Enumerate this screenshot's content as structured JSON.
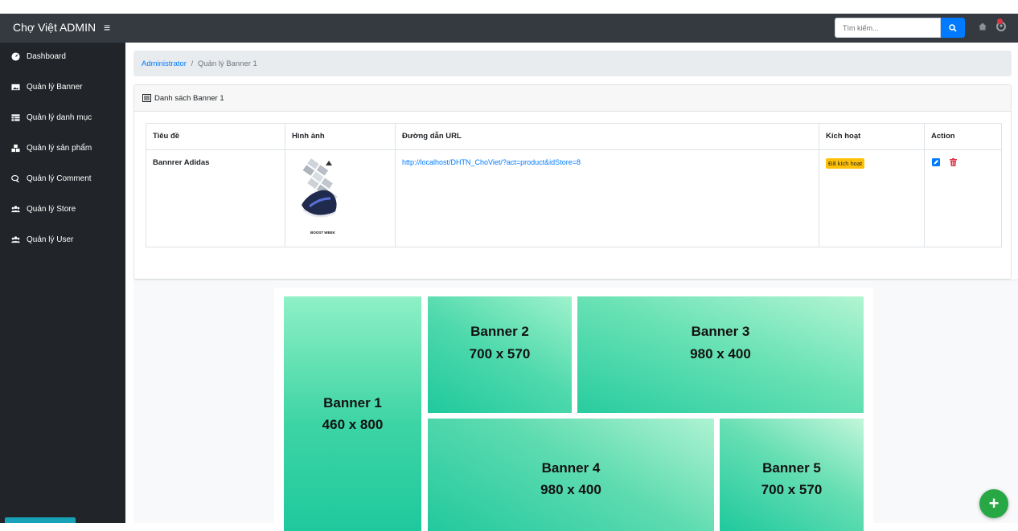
{
  "header": {
    "brand": "Chợ Việt ADMIN",
    "menu_icon": "hamburger-icon",
    "search_placeholder": "Tìm kiếm..."
  },
  "sidebar": {
    "items": [
      {
        "label": "Dashboard",
        "icon": "tachometer-icon"
      },
      {
        "label": "Quản lý Banner",
        "icon": "image-icon"
      },
      {
        "label": "Quản lý danh mục",
        "icon": "table-icon"
      },
      {
        "label": "Quản lý sản phẩm",
        "icon": "cubes-icon"
      },
      {
        "label": "Quản lý Comment",
        "icon": "comments-icon"
      },
      {
        "label": "Quản lý Store",
        "icon": "users-icon"
      },
      {
        "label": "Quản lý User",
        "icon": "users-icon"
      }
    ]
  },
  "breadcrumb": {
    "root": "Administrator",
    "separator": "/",
    "current": "Quản lý Banner 1"
  },
  "card": {
    "title": "Danh sách Banner 1"
  },
  "table": {
    "headers": [
      "Tiêu đề",
      "Hình ảnh",
      "Đường dẫn URL",
      "Kích hoạt",
      "Action"
    ],
    "rows": [
      {
        "title": "Bannrer Adidas",
        "image_caption": "BOOST WEEK",
        "url": "http://localhost/DHTN_ChoViet/?act=product&idStore=8",
        "status": "Đã kích hoạt"
      }
    ]
  },
  "banners": [
    {
      "name": "Banner 1",
      "size": "460 x 800"
    },
    {
      "name": "Banner 2",
      "size": "700 x 570"
    },
    {
      "name": "Banner 3",
      "size": "980 x 400"
    },
    {
      "name": "Banner 4",
      "size": "980 x 400"
    },
    {
      "name": "Banner 5",
      "size": "700 x 570"
    }
  ],
  "colors": {
    "topbar": "#343a40",
    "sidebar": "#212529",
    "accent": "#007bff",
    "badge": "#ffc107",
    "fab": "#28a745"
  }
}
